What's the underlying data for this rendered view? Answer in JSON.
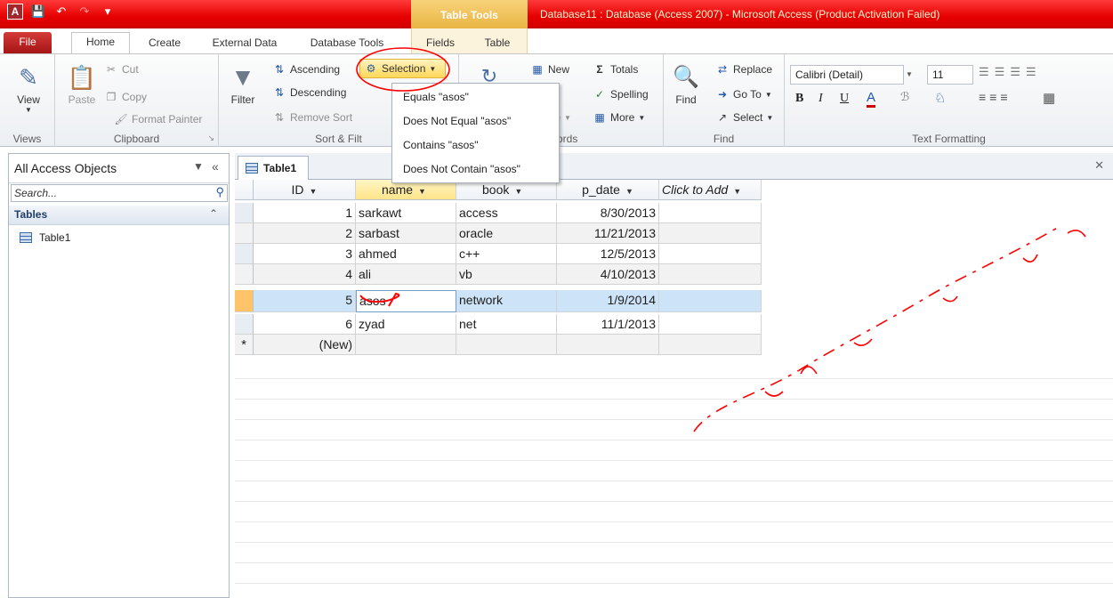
{
  "title_bar": {
    "logo": "A",
    "context_tab": "Table Tools",
    "window_title": "Database11 : Database (Access 2007)  -  Microsoft Access (Product Activation Failed)"
  },
  "ribbon_tabs": [
    "File",
    "Home",
    "Create",
    "External Data",
    "Database Tools",
    "Fields",
    "Table"
  ],
  "views": {
    "view": "View",
    "label": "Views"
  },
  "clipboard": {
    "paste": "Paste",
    "cut": "Cut",
    "copy": "Copy",
    "format_painter": "Format Painter",
    "label": "Clipboard"
  },
  "sort_filter": {
    "filter": "Filter",
    "ascending": "Ascending",
    "descending": "Descending",
    "remove_sort": "Remove Sort",
    "selection": "Selection",
    "label": "Sort & Filt"
  },
  "records": {
    "new": "New",
    "totals": "Totals",
    "spelling": "Spelling",
    "delete_part": "te",
    "more": "More",
    "label": "ords"
  },
  "find": {
    "find": "Find",
    "replace": "Replace",
    "goto": "Go To",
    "select": "Select",
    "label": "Find"
  },
  "text_formatting": {
    "font": "Calibri (Detail)",
    "size": "11",
    "label": "Text Formatting"
  },
  "selection_menu": [
    "Equals \"asos\"",
    "Does Not Equal \"asos\"",
    "Contains \"asos\"",
    "Does Not Contain \"asos\""
  ],
  "nav": {
    "header": "All Access Objects",
    "search_placeholder": "Search...",
    "group": "Tables",
    "items": [
      "Table1"
    ]
  },
  "doc_tab": "Table1",
  "table": {
    "columns": [
      "ID",
      "name",
      "book",
      "p_date",
      "Click to Add"
    ],
    "rows": [
      [
        "1",
        "sarkawt",
        "access",
        "8/30/2013"
      ],
      [
        "2",
        "sarbast",
        "oracle",
        "11/21/2013"
      ],
      [
        "3",
        "ahmed",
        "c++",
        "12/5/2013"
      ],
      [
        "4",
        "ali",
        "vb",
        "4/10/2013"
      ],
      [
        "5",
        "asos",
        "network",
        "1/9/2014"
      ],
      [
        "6",
        "zyad",
        "net",
        "11/1/2013"
      ]
    ],
    "new_row": "(New)",
    "new_marker": "*"
  },
  "colors": {
    "title_red": "#e60000",
    "context_gold": "#eab543",
    "selection_yellow": "#ffd75a",
    "row_select": "#cde3f7",
    "annotation_red": "#ff0000"
  }
}
